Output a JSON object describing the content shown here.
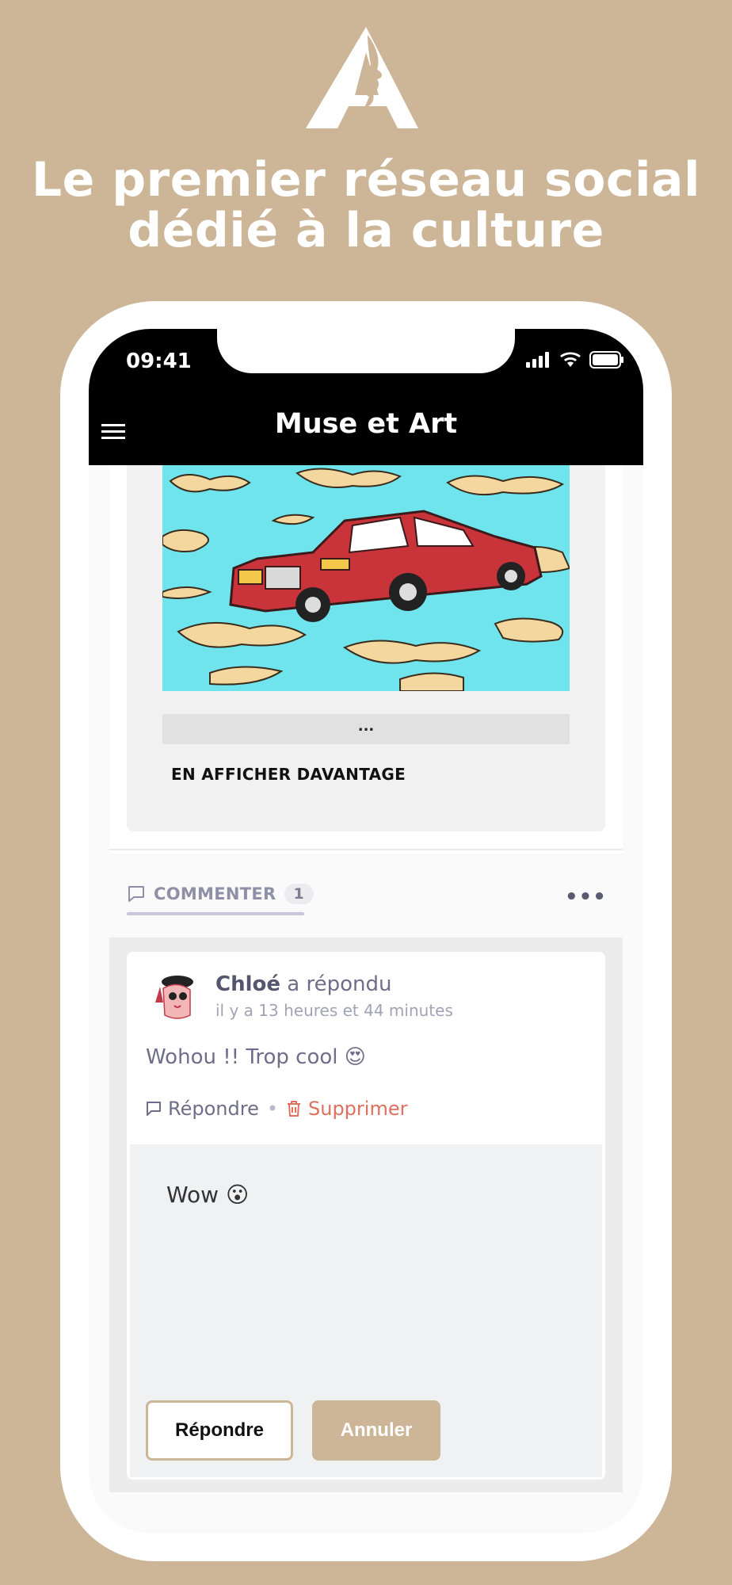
{
  "brand": {
    "headline_line1": "Le premier réseau social",
    "headline_line2": "dédié à la culture"
  },
  "status_bar": {
    "time": "09:41"
  },
  "app_bar": {
    "title": "Muse et Art",
    "menu_icon": "hamburger-icon"
  },
  "post": {
    "ellipsis": "...",
    "show_more_label": "EN AFFICHER DAVANTAGE"
  },
  "comment_bar": {
    "label": "COMMENTER",
    "count": "1",
    "more_icon": "•••"
  },
  "comment": {
    "author": "Chloé",
    "action": "a répondu",
    "timestamp": "il y a 13 heures et 44 minutes",
    "text": "Wohou !! Trop cool 😍",
    "reply_label": "Répondre",
    "separator": "•",
    "delete_label": "Supprimer"
  },
  "reply_form": {
    "value": "Wow 😮",
    "submit_label": "Répondre",
    "cancel_label": "Annuler"
  },
  "colors": {
    "background": "#cdb597",
    "app_bar": "#000000",
    "delete": "#e0705e"
  }
}
